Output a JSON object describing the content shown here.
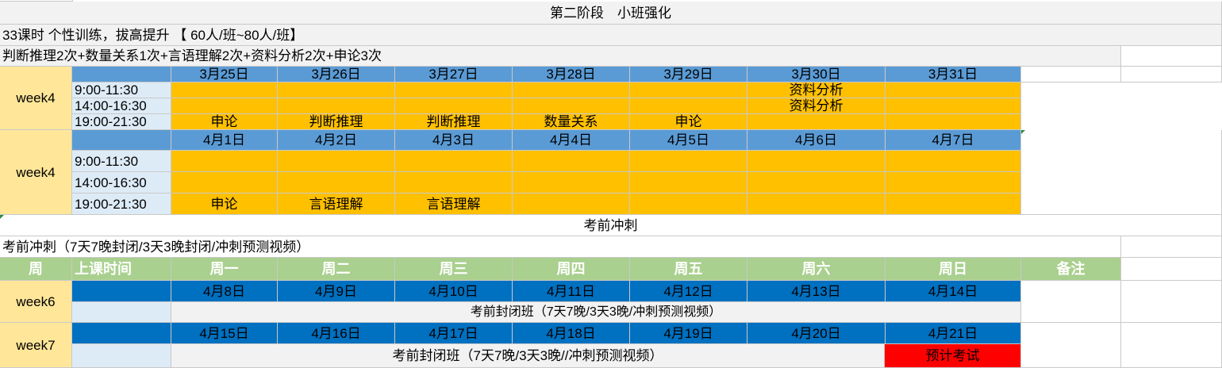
{
  "stage2": {
    "title": "第二阶段　小班强化",
    "desc1": "33课时 个性训练，拔高提升 【 60人/班~80人/班】",
    "desc2": "判断推理2次+数量关系1次+言语理解2次+资料分析2次+申论3次"
  },
  "block1": {
    "week": "week4",
    "dates": [
      "3月25日",
      "3月26日",
      "3月27日",
      "3月28日",
      "3月29日",
      "3月30日",
      "3月31日"
    ],
    "times": [
      "9:00-11:30",
      "14:00-16:30",
      "19:00-21:30"
    ],
    "rows": [
      [
        "",
        "",
        "",
        "",
        "",
        "资料分析",
        ""
      ],
      [
        "",
        "",
        "",
        "",
        "",
        "资料分析",
        ""
      ],
      [
        "申论",
        "判断推理",
        "判断推理",
        "数量关系",
        "申论",
        "",
        ""
      ]
    ]
  },
  "block2": {
    "week": "week4",
    "dates": [
      "4月1日",
      "4月2日",
      "4月3日",
      "4月4日",
      "4月5日",
      "4月6日",
      "4月7日"
    ],
    "times": [
      "9:00-11:30",
      "14:00-16:30",
      "19:00-21:30"
    ],
    "rows": [
      [
        "",
        "",
        "",
        "",
        "",
        "",
        ""
      ],
      [
        "",
        "",
        "",
        "",
        "",
        "",
        ""
      ],
      [
        "申论",
        "言语理解",
        "言语理解",
        "",
        "",
        "",
        ""
      ]
    ]
  },
  "sprint": {
    "title": "考前冲刺",
    "desc": "考前冲刺（7天7晚封闭/3天3晚封闭/冲刺预测视频）"
  },
  "header": {
    "week": "周",
    "time": "上课时间",
    "days": [
      "周一",
      "周二",
      "周三",
      "周四",
      "周五",
      "周六",
      "周日"
    ],
    "remark": "备注"
  },
  "week6": {
    "week": "week6",
    "dates": [
      "4月8日",
      "4月9日",
      "4月10日",
      "4月11日",
      "4月12日",
      "4月13日",
      "4月14日"
    ],
    "content": "考前封闭班（7天7晚/3天3晚/冲刺预测视频）"
  },
  "week7": {
    "week": "week7",
    "dates": [
      "4月15日",
      "4月16日",
      "4月17日",
      "4月18日",
      "4月19日",
      "4月20日",
      "4月21日"
    ],
    "content": "考前封闭班（7天7晚/3天3晚//冲刺预测视频）",
    "exam": "预计考试"
  },
  "colors": {
    "header_blue": "#5b9bd5",
    "course_orange": "#ffc000",
    "week_peach": "#ffe699",
    "time_blue": "#ddebf7",
    "header_green": "#a9d08e",
    "date_blue": "#0070c0",
    "exam_red": "#ff0000"
  }
}
